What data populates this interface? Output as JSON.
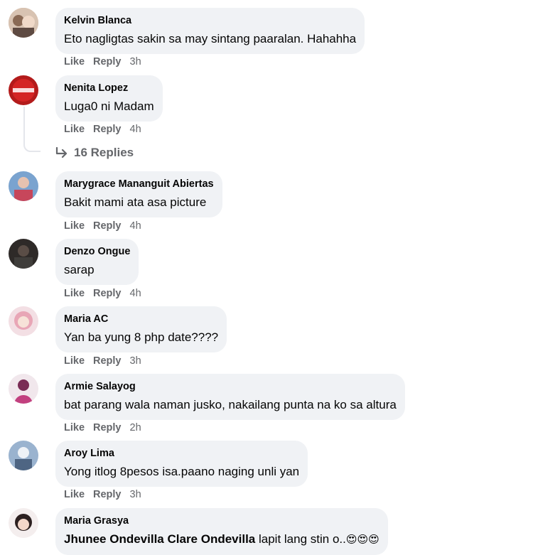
{
  "comments": [
    {
      "author": "Kelvin Blanca",
      "text": "Eto nagligtas sakin sa may sintang paaralan. Hahahha",
      "actions": {
        "like": "Like",
        "reply": "Reply",
        "time": "3h"
      }
    },
    {
      "author": "Nenita Lopez",
      "text": "Luga0 ni Madam",
      "actions": {
        "like": "Like",
        "reply": "Reply",
        "time": "4h"
      }
    },
    {
      "author": "Marygrace Mananguit Abiertas",
      "text": "Bakit mami ata asa picture",
      "actions": {
        "like": "Like",
        "reply": "Reply",
        "time": "4h"
      }
    },
    {
      "author": "Denzo Ongue",
      "text": "sarap",
      "actions": {
        "like": "Like",
        "reply": "Reply",
        "time": "4h"
      }
    },
    {
      "author": "Maria AC",
      "text": "Yan ba yung 8 php date????",
      "actions": {
        "like": "Like",
        "reply": "Reply",
        "time": "3h"
      }
    },
    {
      "author": "Armie Salayog",
      "text": "bat parang wala naman jusko, nakailang punta na ko sa altura",
      "actions": {
        "like": "Like",
        "reply": "Reply",
        "time": "2h"
      }
    },
    {
      "author": "Aroy Lima",
      "text": "Yong itlog 8pesos isa.paano naging unli yan",
      "actions": {
        "like": "Like",
        "reply": "Reply",
        "time": "3h"
      }
    },
    {
      "author": "Maria Grasya",
      "mention": "Jhunee Ondevilla Clare Ondevilla",
      "text": " lapit lang stin o..",
      "emoji": "😍😍😍"
    }
  ],
  "replies_link": "16 Replies",
  "avatar_colors": [
    "#c9a58c",
    "#b31b1b",
    "#6f97c4",
    "#3b3330",
    "#e8b6bf",
    "#9b3d6e",
    "#6d87a8",
    "#e9d7d5"
  ],
  "icons": {
    "reply_arrow": "reply-arrow-icon"
  }
}
